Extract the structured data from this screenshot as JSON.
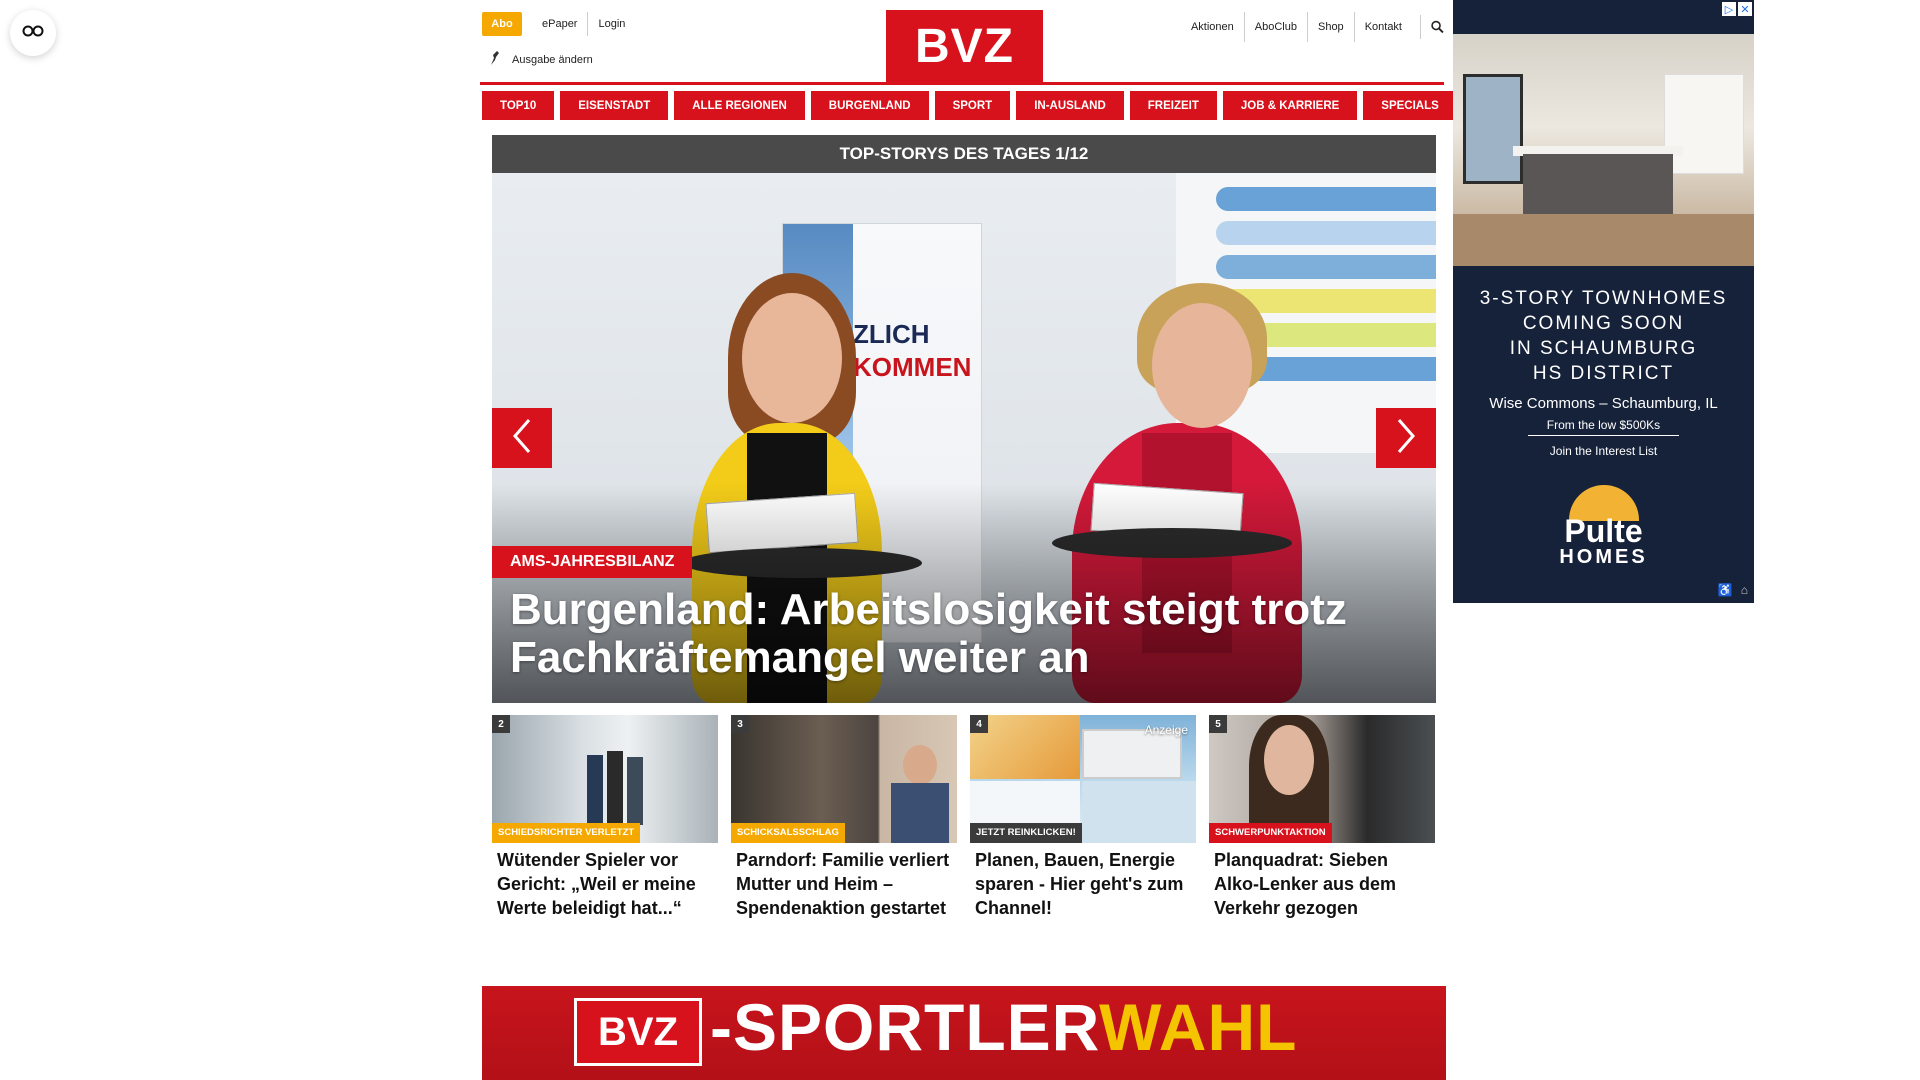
{
  "header": {
    "abo": "Abo",
    "links_left": [
      "ePaper",
      "Login"
    ],
    "edition": "Ausgabe ändern",
    "logo": "BVZ",
    "links_right": [
      "Aktionen",
      "AboClub",
      "Shop",
      "Kontakt"
    ]
  },
  "nav": [
    "TOP10",
    "EISENSTADT",
    "ALLE REGIONEN",
    "BURGENLAND",
    "SPORT",
    "IN-AUSLAND",
    "FREIZEIT",
    "JOB & KARRIERE",
    "SPECIALS"
  ],
  "top_stories": {
    "label": "TOP-STORYS DES TAGES 1/12",
    "hero": {
      "kicker": "AMS-JAHRESBILANZ",
      "title": "Burgenland: Arbeitslosigkeit steigt trotz Fachkräftemangel weiter an",
      "banner_line1": "ZLICH",
      "banner_line2": "KOMMEN"
    },
    "cards": [
      {
        "num": "2",
        "tag": "SCHIEDSRICHTER VERLETZT",
        "tag_color": "#f5a800",
        "title": "Wütender Spieler vor Gericht: „Weil er meine Werte beleidigt hat...“"
      },
      {
        "num": "3",
        "tag": "SCHICKSALSSCHLAG",
        "tag_color": "#f5a800",
        "title": "Parndorf: Familie verliert Mutter und Heim – Spendenaktion gestartet"
      },
      {
        "num": "4",
        "tag": "JETZT REINKLICKEN!",
        "tag_color": "#3b3b3b",
        "title": "Planen, Bauen, Energie sparen - Hier geht's zum Channel!",
        "badge": "Anzeige"
      },
      {
        "num": "5",
        "tag": "SCHWERPUNKTAKTION",
        "tag_color": "#d8121c",
        "title": "Planquadrat: Sieben Alko-Lenker aus dem Verkehr gezogen"
      }
    ]
  },
  "sport_banner": {
    "logo": "BVZ",
    "text_white": "-SPORTLER",
    "text_yellow": "WAHL"
  },
  "ad": {
    "headline": [
      "3-STORY TOWNHOMES",
      "COMING SOON",
      "IN SCHAUMBURG",
      "HS DISTRICT"
    ],
    "sub": "Wise Commons – Schaumburg, IL",
    "price": "From the low $500Ks",
    "interest": "Join the Interest List",
    "brand_top": "Pulte",
    "brand_bottom": "HOMES"
  },
  "colors": {
    "brand_red": "#d8121c",
    "abo_orange": "#f5a800",
    "bar_gray": "#4a4a4a",
    "ad_navy": "#16213a"
  }
}
